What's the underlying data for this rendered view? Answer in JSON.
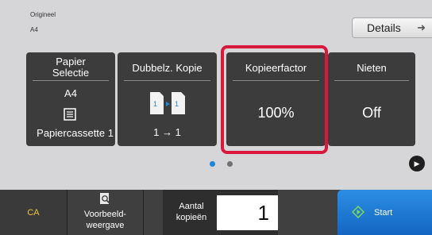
{
  "original": {
    "label": "Origineel",
    "value": "A4"
  },
  "details_button": {
    "label": "Details",
    "icon": "arrow-right-icon"
  },
  "tiles": {
    "paper": {
      "title_line1": "Papier",
      "title_line2": "Selectie",
      "size": "A4",
      "icon": "paper-tray-icon",
      "source": "Papiercassette 1"
    },
    "duplex": {
      "title": "Dubbelz. Kopie",
      "icon": "duplex-copy-icon",
      "value": "1 → 1"
    },
    "ratio": {
      "title": "Kopieerfactor",
      "value": "100%"
    },
    "staple": {
      "title": "Nieten",
      "value": "Off"
    }
  },
  "pagination": {
    "current_page": 1,
    "page_count": 2
  },
  "bottom_bar": {
    "ca_label": "CA",
    "preview_line1": "Voorbeeld-",
    "preview_line2": "weergave",
    "copies_line1": "Aantal",
    "copies_line2": "kopieën",
    "copies_value": "1",
    "start_label": "Start"
  },
  "colors": {
    "highlight": "#d8193c",
    "start_button": "#1f7ad3",
    "ca_text": "#f0c23c",
    "active_dot": "#1e86d8",
    "tile_bg": "#3c3c3c"
  }
}
